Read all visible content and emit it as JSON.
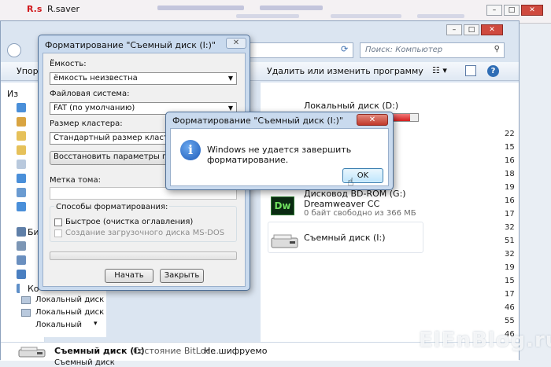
{
  "rsaver": {
    "logo": "R.s",
    "title": "R.saver"
  },
  "explorer": {
    "search_placeholder": "Поиск: Компьютер",
    "toolbar": {
      "organize": "Упора",
      "uninstall": "Удалить или изменить программу"
    },
    "nav": {
      "favorites_head": "Из",
      "libraries_head": "Би",
      "computer_head": "Ко",
      "local_disk_1": "Локальный диск",
      "local_disk_2": "Локальный диск",
      "local_disk_3": "Локальный"
    },
    "content": {
      "local_disk_d": "Локальный диск (D:)",
      "dvd_drive": "Дисковод BD-ROM (G:)",
      "dvd_label": "Dreamweaver CC",
      "dvd_free": "0 байт свободно из 366 МБ",
      "removable": "Съемный диск (I:)"
    },
    "size_column": [
      "22",
      "15",
      "16",
      "18",
      "19",
      "16",
      "17",
      "32",
      "51",
      "32",
      "19",
      "15",
      "17",
      "46",
      "55",
      "46"
    ],
    "status": {
      "name": "Съемный диск (I:)",
      "bitlocker_label": "Состояние BitLoc...",
      "bitlocker_value": "Не шифруемо",
      "type": "Съемный диск"
    },
    "disk_usage_fraction": 0.93
  },
  "format_dialog": {
    "title": "Форматирование \"Съемный диск (I:)\"",
    "capacity_label": "Ёмкость:",
    "capacity_value": "ёмкость неизвестна",
    "fs_label": "Файловая система:",
    "fs_value": "FAT (по умолчанию)",
    "cluster_label": "Размер кластера:",
    "cluster_value": "Стандартный размер кластера",
    "restore_button": "Восстановить параметры по умолчанию",
    "volume_label": "Метка тома:",
    "options_label": "Способы форматирования:",
    "quick_format": "Быстрое (очистка оглавления)",
    "quick_format_checked": false,
    "msdos_disk": "Создание загрузочного диска MS-DOS",
    "msdos_checked": false,
    "start_button": "Начать",
    "close_button": "Закрыть",
    "progress": 0
  },
  "error_dialog": {
    "title": "Форматирование \"Съемный диск (I:)\"",
    "message": "Windows не удается завершить форматирование.",
    "ok_button": "OK",
    "close_glyph": "✕"
  },
  "watermark": "ElEnBlog.ru"
}
